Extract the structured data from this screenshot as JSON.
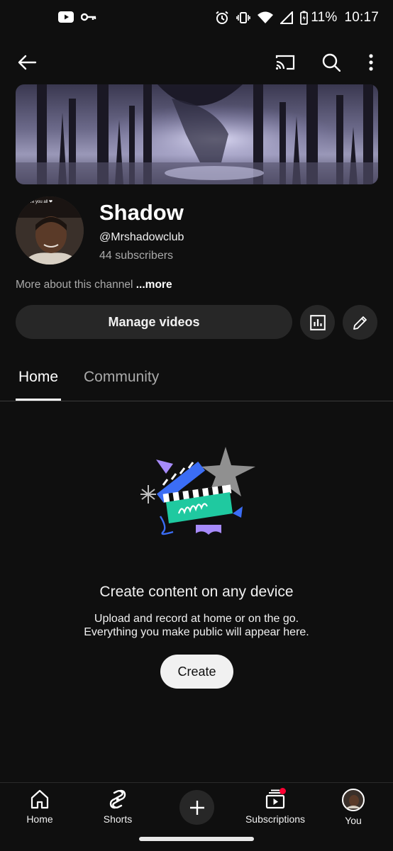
{
  "status_bar": {
    "battery": "11%",
    "time": "10:17"
  },
  "channel": {
    "name": "Shadow",
    "handle": "@Mrshadowclub",
    "subscribers": "44 subscribers",
    "about_text": "More about this channel",
    "about_more": "...more",
    "avatar_caption": "ve you all ❤"
  },
  "actions": {
    "manage_videos": "Manage videos"
  },
  "tabs": [
    {
      "label": "Home",
      "selected": true
    },
    {
      "label": "Community",
      "selected": false
    }
  ],
  "empty_state": {
    "title": "Create content on any device",
    "line1": "Upload and record at home or on the go.",
    "line2": "Everything you make public will appear here.",
    "button": "Create"
  },
  "bottom_nav": {
    "home": "Home",
    "shorts": "Shorts",
    "subscriptions": "Subscriptions",
    "you": "You"
  },
  "colors": {
    "background": "#0f0f0f",
    "surface": "#272727",
    "text_secondary": "#aaaaaa",
    "notification": "#ff0033"
  },
  "icons": {
    "back": "arrow-left-icon",
    "cast": "cast-icon",
    "search": "search-icon",
    "more": "more-vert-icon",
    "analytics": "bar-chart-icon",
    "edit": "pencil-icon"
  }
}
